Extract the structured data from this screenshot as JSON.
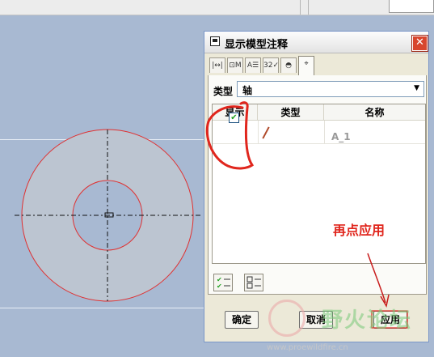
{
  "dialog": {
    "title": "显示模型注释",
    "close_icon": "close-icon",
    "tabs": [
      {
        "icon": "dimension-icon",
        "glyph": "|↔|"
      },
      {
        "icon": "gtol-icon",
        "glyph": "⊡M"
      },
      {
        "icon": "note-icon",
        "glyph": "A☰"
      },
      {
        "icon": "surface-finish-icon",
        "glyph": "32✓"
      },
      {
        "icon": "datum-target-icon",
        "glyph": "◓"
      },
      {
        "icon": "datum-icon",
        "glyph": "⌖"
      }
    ],
    "type_label": "类型",
    "type_value": "轴",
    "table": {
      "headers": [
        "显示",
        "类型",
        "名称"
      ],
      "rows": [
        {
          "checked": true,
          "type_icon": "axis-icon",
          "name": "A_1"
        }
      ]
    },
    "select_all_icon": "select-all-icon",
    "deselect_all_icon": "deselect-all-icon",
    "buttons": {
      "ok": "确定",
      "cancel": "取消",
      "apply": "应用"
    }
  },
  "annotations": {
    "instruction": "再点应用",
    "watermark": "野火论坛",
    "watermark_url": "www.proewildfire.cn"
  },
  "colors": {
    "viewport_bg": "#a8b9d2",
    "part_fill": "#bcc5d1",
    "edge_red": "#e03030",
    "annotation_red": "#e0261d"
  }
}
